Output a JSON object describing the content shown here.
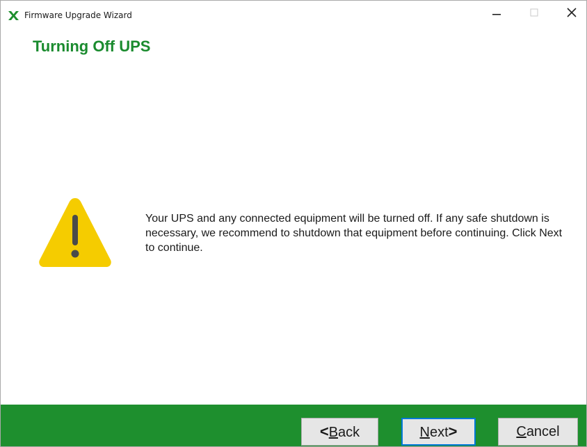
{
  "window": {
    "title": "Firmware Upgrade Wizard",
    "controls": {
      "minimize_icon": "minimize-icon",
      "maximize_icon": "maximize-icon",
      "close_icon": "close-icon"
    },
    "app_icon": "app-x-logo-icon",
    "colors": {
      "brand_green": "#1e8f2e",
      "title_green": "#1a8b2e",
      "warning_yellow": "#f5cc00"
    }
  },
  "page": {
    "title": "Turning Off UPS",
    "warning_icon": "warning-icon",
    "message": "Your UPS and any connected equipment will be turned off.  If any safe shutdown is necessary, we recommend to shutdown that equipment before continuing. Click Next to continue."
  },
  "buttons": {
    "back": {
      "prefix": "<",
      "mnemonic": "B",
      "rest": "ack"
    },
    "next": {
      "mnemonic": "N",
      "rest": "ext",
      "suffix": ">"
    },
    "cancel": {
      "mnemonic": "C",
      "rest": "ancel"
    }
  }
}
